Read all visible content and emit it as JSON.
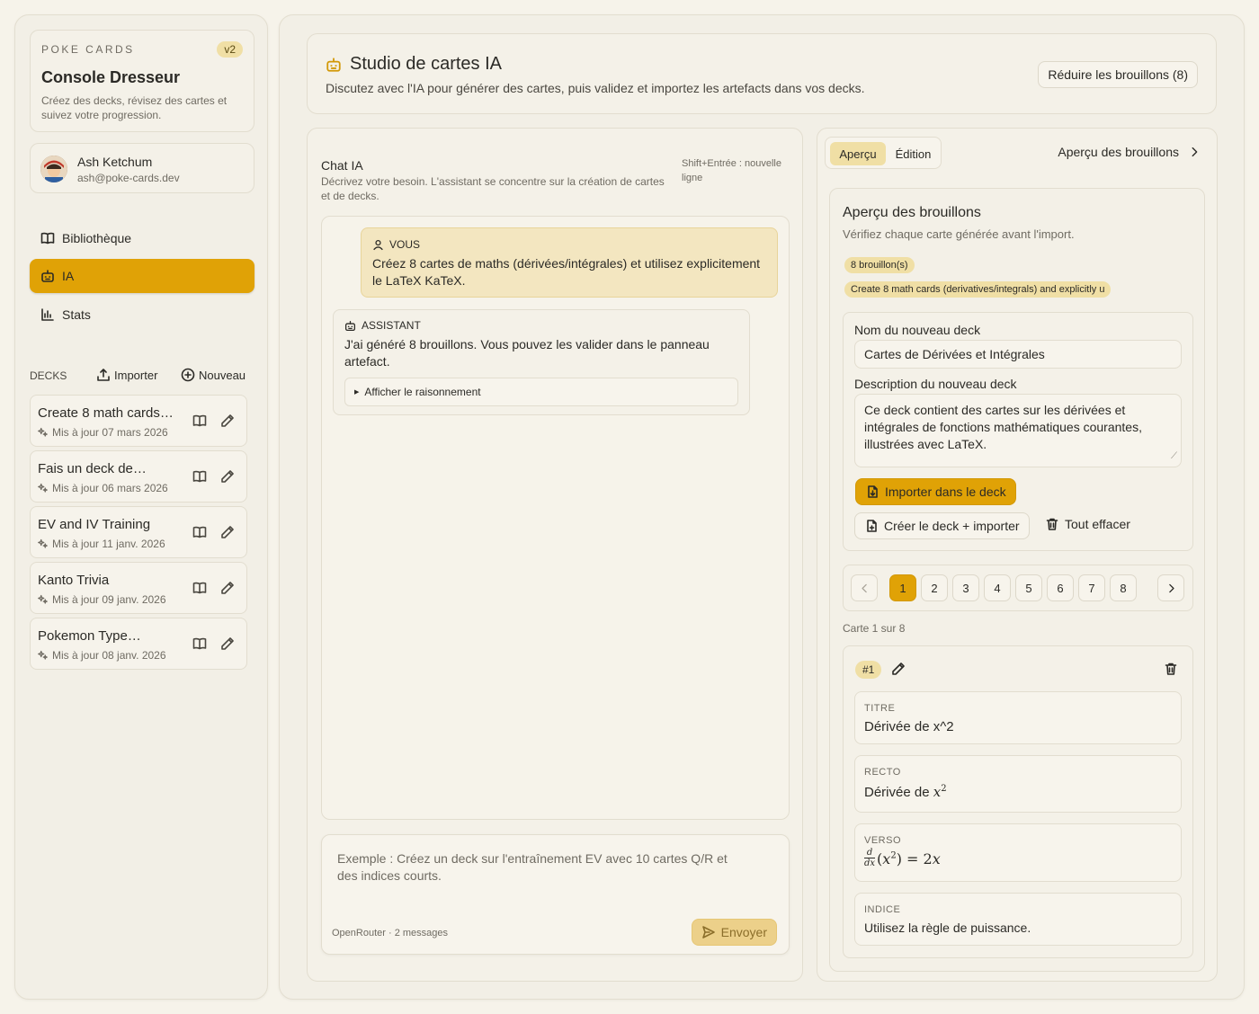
{
  "sidebar": {
    "brand": {
      "label": "POKE CARDS",
      "version": "v2",
      "title": "Console Dresseur",
      "description": "Créez des decks, révisez des cartes et suivez votre progression."
    },
    "user": {
      "name": "Ash Ketchum",
      "email": "ash@poke-cards.dev"
    },
    "nav": [
      {
        "label": "Bibliothèque",
        "icon": "book-icon"
      },
      {
        "label": "IA",
        "icon": "bot-icon",
        "active": true
      },
      {
        "label": "Stats",
        "icon": "chart-icon"
      }
    ],
    "decks_label": "DECKS",
    "import_label": "Importer",
    "new_label": "Nouveau",
    "decks": [
      {
        "title": "Create 8 math cards…",
        "updated": "Mis à jour 07 mars 2026"
      },
      {
        "title": "Fais un deck de…",
        "updated": "Mis à jour 06 mars 2026"
      },
      {
        "title": "EV and IV Training",
        "updated": "Mis à jour 11 janv. 2026"
      },
      {
        "title": "Kanto Trivia",
        "updated": "Mis à jour 09 janv. 2026"
      },
      {
        "title": "Pokemon Type…",
        "updated": "Mis à jour 08 janv. 2026"
      }
    ]
  },
  "header": {
    "title": "Studio de cartes IA",
    "subtitle": "Discutez avec l'IA pour générer des cartes, puis validez et importez les artefacts dans vos decks.",
    "collapse_button": "Réduire les brouillons (8)"
  },
  "chat": {
    "title": "Chat IA",
    "description": "Décrivez votre besoin. L'assistant se concentre sur la création de cartes et de decks.",
    "hint": "Shift+Entrée : nouvelle ligne",
    "messages": [
      {
        "role": "VOUS",
        "text": "Créez 8 cartes de maths (dérivées/intégrales) et utilisez explicitement le LaTeX KaTeX."
      },
      {
        "role": "ASSISTANT",
        "text": "J'ai généré 8 brouillons. Vous pouvez les valider dans le panneau artefact.",
        "reasoning_toggle": "Afficher le raisonnement"
      }
    ],
    "input_placeholder": "Exemple : Créez un deck sur l'entraînement EV avec 10 cartes Q/R et des indices courts.",
    "footer_info": "OpenRouter · 2 messages",
    "send_label": "Envoyer"
  },
  "artifact": {
    "tabs": [
      {
        "label": "Aperçu",
        "active": true
      },
      {
        "label": "Édition"
      }
    ],
    "header_title": "Aperçu des brouillons",
    "section_title": "Aperçu des brouillons",
    "section_subtitle": "Vérifiez chaque carte générée avant l'import.",
    "draft_count_badge": "8 brouillon(s)",
    "prompt_badge": "Create 8 math cards (derivatives/integrals) and explicitly u",
    "deck_name_label": "Nom du nouveau deck",
    "deck_name_value": "Cartes de Dérivées et Intégrales",
    "deck_desc_label": "Description du nouveau deck",
    "deck_desc_value": "Ce deck contient des cartes sur les dérivées et intégrales de fonctions mathématiques courantes, illustrées avec LaTeX.",
    "import_button": "Importer dans le deck",
    "create_import_button": "Créer le deck + importer",
    "clear_button": "Tout effacer",
    "pages": [
      "1",
      "2",
      "3",
      "4",
      "5",
      "6",
      "7",
      "8"
    ],
    "active_page": 1,
    "card_counter": "Carte 1 sur 8",
    "card": {
      "number": "#1",
      "title_label": "TITRE",
      "title_value": "Dérivée de x^2",
      "front_label": "RECTO",
      "front_text": "Dérivée de",
      "back_label": "VERSO",
      "hint_label": "INDICE",
      "hint_value": "Utilisez la règle de puissance."
    }
  }
}
